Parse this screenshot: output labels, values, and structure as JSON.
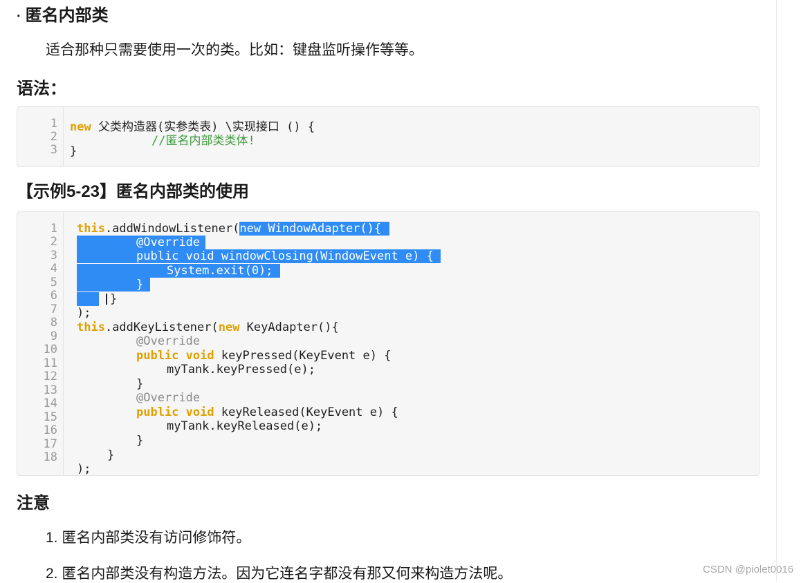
{
  "section_title": "匿名内部类",
  "bullet": "·",
  "intro": "适合那种只需要使用一次的类。比如：键盘监听操作等等。",
  "syntax_heading": "语法：",
  "syntax_code": {
    "line_numbers": [
      "1",
      "2",
      "3"
    ],
    "line1_kw": "new",
    "line1_rest": " 父类构造器(实参类表) \\实现接口 () {",
    "line2": "//匿名内部类类体!",
    "line3": "}"
  },
  "example_heading": "【示例5-23】匿名内部类的使用",
  "example_code": {
    "line_numbers": [
      "1",
      "2",
      "3",
      "4",
      "5",
      "6",
      "7",
      "8",
      "9",
      "10",
      "11",
      "12",
      "13",
      "14",
      "15",
      "16",
      "17",
      "18"
    ],
    "l1_this": "this",
    "l1_a": ".addWindowListener(",
    "l1_sel": "new WindowAdapter(){",
    "l2": "@Override",
    "l3_kw": "public void",
    "l3_rest": " windowClosing(WindowEvent e) {",
    "l4": "System.exit(0);",
    "l5": "}",
    "l6": "}",
    "l7": ");",
    "l8_this": "this",
    "l8_a": ".addKeyListener(",
    "l8_new": "new",
    "l8_b": " KeyAdapter(){",
    "l9": "@Override",
    "l10_kw": "public void",
    "l10_rest": " keyPressed(KeyEvent e) {",
    "l11": "myTank.keyPressed(e);",
    "l12": "}",
    "l13": "@Override",
    "l14_kw": "public void",
    "l14_rest": " keyReleased(KeyEvent e) {",
    "l15": "myTank.keyReleased(e);",
    "l16": "}",
    "l17": "}",
    "l18": ");"
  },
  "notes_heading": "注意",
  "notes": [
    "1. 匿名内部类没有访问修饰符。",
    "2. 匿名内部类没有构造方法。因为它连名字都没有那又何来构造方法呢。"
  ],
  "watermark": "CSDN @piolet0016",
  "colors": {
    "keyword": "#e0a000",
    "comment": "#3a9a3a",
    "annotation": "#8a8a8a",
    "selection": "#2f8cf5"
  }
}
